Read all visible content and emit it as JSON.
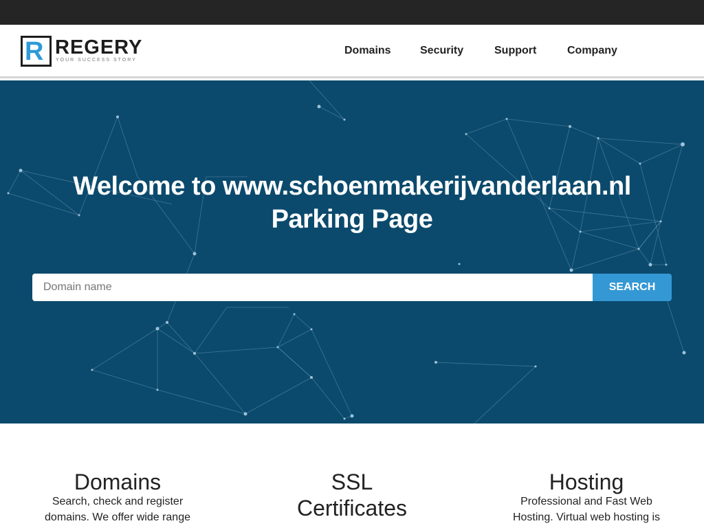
{
  "logo": {
    "mark": "R",
    "name": "REGERY",
    "tagline": "YOUR SUCCESS STORY"
  },
  "nav": {
    "items": [
      "Domains",
      "Security",
      "Support",
      "Company"
    ]
  },
  "hero": {
    "title_line1": "Welcome to www.schoenmakerijvanderlaan.nl",
    "title_line2": "Parking Page",
    "search_placeholder": "Domain name",
    "search_button": "SEARCH"
  },
  "features": [
    {
      "title": "Domains",
      "text_line1": "Search, check and register",
      "text_line2": "domains. We offer wide range"
    },
    {
      "title_line1": "SSL",
      "title_line2": "Certificates"
    },
    {
      "title": "Hosting",
      "text_line1": "Professional and Fast Web",
      "text_line2": "Hosting. Virtual web hosting is"
    }
  ],
  "colors": {
    "topbar": "#252525",
    "hero_bg": "#0b4a6d",
    "accent": "#3498d4",
    "text": "#222222"
  }
}
